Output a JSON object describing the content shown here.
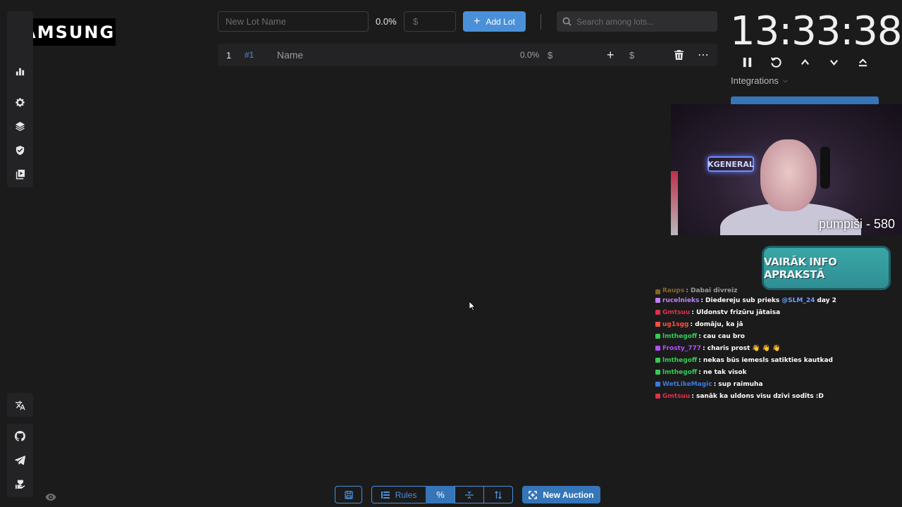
{
  "overlay": {
    "brand_logo": "SAMSUNG"
  },
  "sidebar": {
    "top_items": [
      "chart-icon",
      "gear-icon",
      "layers-icon",
      "shield-check-icon",
      "video-playlist-icon"
    ],
    "translate_icon": "translate-icon",
    "bottom_items": [
      "github-icon",
      "telegram-icon",
      "donate-hand-heart-icon"
    ],
    "visibility_icon": "eye-icon"
  },
  "toolbar": {
    "lot_name_placeholder": "New Lot Name",
    "percent": "0.0%",
    "amount_placeholder": "$",
    "add_lot_label": "Add Lot",
    "search_placeholder": "Search among lots..."
  },
  "lots": [
    {
      "index": "1",
      "id": "#1",
      "name": "Name",
      "percent": "0.0%",
      "currency": "$",
      "add": "+",
      "add_currency": "$"
    }
  ],
  "timer": {
    "value": "13:33:38",
    "controls": [
      "pause-icon",
      "reset-icon",
      "chevron-up-icon",
      "chevron-down-icon",
      "double-chevron-up-icon"
    ]
  },
  "integrations": {
    "label": "Integrations"
  },
  "webcam": {
    "sign_text": "KGENERAL",
    "label": "pumpiši - 580"
  },
  "banner": {
    "text": "VAIRĀK INFO APRAKSTĀ"
  },
  "chat": [
    {
      "user": "Raups",
      "color": "#e0a030",
      "text": ": Dabai divreiz",
      "faded": true
    },
    {
      "user": "rucelnieks",
      "color": "#c080ff",
      "text": ": Diedereju sub prieks",
      "mention": "@SLM_24",
      "after": "day 2"
    },
    {
      "user": "Gmtsuu",
      "color": "#e0304a",
      "text": ": Uldonstv frizūru jātaisa"
    },
    {
      "user": "ug1sgg",
      "color": "#ff5040",
      "text": ": domāju, ka jā"
    },
    {
      "user": "lmthegoff",
      "color": "#33cc55",
      "text": ": cau cau bro"
    },
    {
      "user": "Frosty_777",
      "color": "#b050ff",
      "text": ": charis prost 👋 👋 👋"
    },
    {
      "user": "lmthegoff",
      "color": "#33cc55",
      "text": ": nekas būs iemesls satikties kautkad"
    },
    {
      "user": "lmthegoff",
      "color": "#33cc55",
      "text": ": ne tak visok"
    },
    {
      "user": "WetLikeMagic",
      "color": "#3a7ae0",
      "text": ": sup raimuha"
    },
    {
      "user": "Gmtsuu",
      "color": "#e0304a",
      "text": ": sanāk ka uldons visu dzīvi sodīts :D"
    }
  ],
  "bottom_bar": {
    "save_icon": "save-icon",
    "rules_label": "Rules",
    "percent_label": "%",
    "new_auction_label": "New Auction"
  }
}
